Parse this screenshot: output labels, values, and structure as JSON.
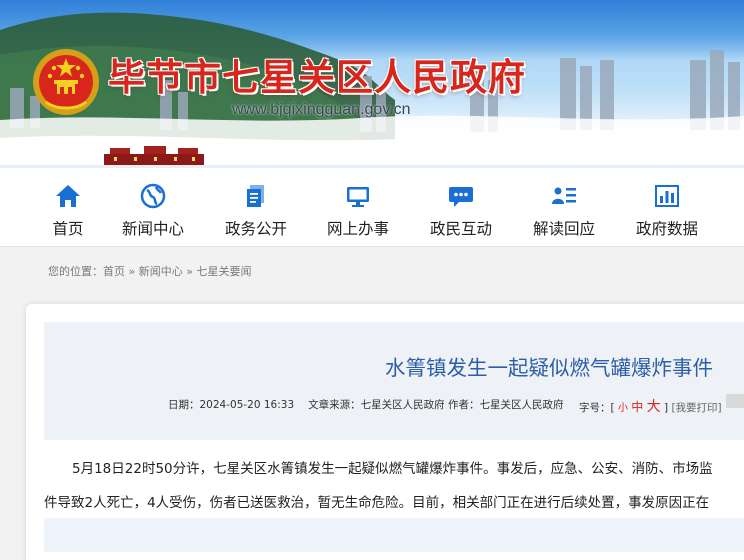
{
  "header": {
    "site_title": "毕节市七星关区人民政府",
    "site_url": "www.bjqixingguan.gov.cn"
  },
  "nav": {
    "items": [
      {
        "label": "首页",
        "icon": "home-icon"
      },
      {
        "label": "新闻中心",
        "icon": "globe-icon"
      },
      {
        "label": "政务公开",
        "icon": "document-icon"
      },
      {
        "label": "网上办事",
        "icon": "monitor-icon"
      },
      {
        "label": "政民互动",
        "icon": "chat-bubble-icon"
      },
      {
        "label": "解读回应",
        "icon": "person-list-icon"
      },
      {
        "label": "政府数据",
        "icon": "bar-chart-icon"
      }
    ]
  },
  "breadcrumb": {
    "prefix": "您的位置：",
    "home": "首页",
    "sep": " » ",
    "level1": "新闻中心",
    "level2": "七星关要闻"
  },
  "article": {
    "title": "水箐镇发生一起疑似燃气罐爆炸事件",
    "date_label": "日期：",
    "date": "2024-05-20 16:33",
    "source_label": "文章来源：",
    "source": "七星关区人民政府",
    "author_label": "作者：",
    "author": "七星关区人民政府",
    "fontsize_label": "字号：[",
    "fontsize_small": "小",
    "fontsize_medium": "中",
    "fontsize_large": "大",
    "fontsize_close": "]",
    "print_label": "[我要打印]",
    "paragraph1": "5月18日22时50分许，七星关区水箐镇发生一起疑似燃气罐爆炸事件。事发后，应急、公安、消防、市场监",
    "paragraph2": "件导致2人死亡，4人受伤，伤者已送医救治，暂无生命危险。目前，相关部门正在进行后续处置，事发原因正在"
  },
  "colors": {
    "title_red": "#d9261c",
    "nav_icon_blue": "#1a6fd4",
    "article_title_blue": "#2d5fa8"
  }
}
